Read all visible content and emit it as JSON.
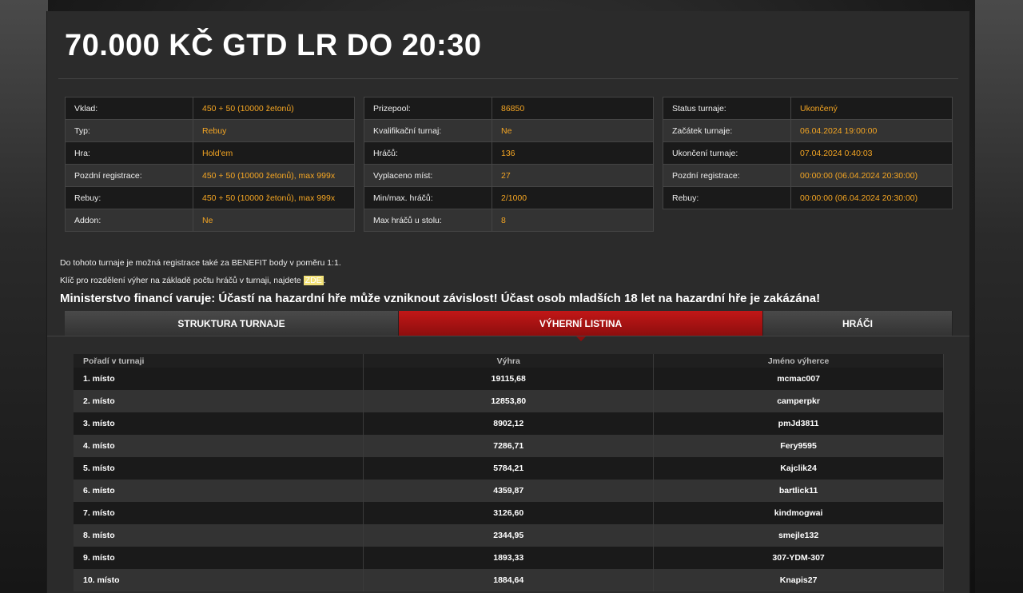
{
  "title": "70.000 KČ GTD LR DO 20:30",
  "info_left": [
    {
      "label": "Vklad:",
      "value": "450 + 50 (10000 žetonů)"
    },
    {
      "label": "Typ:",
      "value": "Rebuy"
    },
    {
      "label": "Hra:",
      "value": "Hold'em"
    },
    {
      "label": "Pozdní registrace:",
      "value": "450 + 50 (10000 žetonů), max 999x"
    },
    {
      "label": "Rebuy:",
      "value": "450 + 50 (10000 žetonů), max 999x"
    },
    {
      "label": "Addon:",
      "value": "Ne"
    }
  ],
  "info_mid": [
    {
      "label": "Prizepool:",
      "value": "86850"
    },
    {
      "label": "Kvalifikační turnaj:",
      "value": "Ne"
    },
    {
      "label": "Hráčů:",
      "value": "136"
    },
    {
      "label": "Vyplaceno míst:",
      "value": "27"
    },
    {
      "label": "Min/max. hráčů:",
      "value": "2/1000"
    },
    {
      "label": "Max hráčů u stolu:",
      "value": "8"
    }
  ],
  "info_right": [
    {
      "label": "Status turnaje:",
      "value": "Ukončený"
    },
    {
      "label": "Začátek turnaje:",
      "value": "06.04.2024 19:00:00"
    },
    {
      "label": "Ukončení turnaje:",
      "value": "07.04.2024 0:40:03"
    },
    {
      "label": "Pozdní registrace:",
      "value": "00:00:00 (06.04.2024 20:30:00)"
    },
    {
      "label": "Rebuy:",
      "value": "00:00:00 (06.04.2024 20:30:00)"
    }
  ],
  "notes": {
    "benefit": "Do tohoto turnaje je možná registrace také za BENEFIT body v poměru 1:1.",
    "key_prefix": "Klíč pro rozdělení výher na základě počtu hráčů v turnaji, najdete ",
    "key_link": "ZDE",
    "key_suffix": "."
  },
  "warning": "Ministerstvo financí varuje: Účastí na hazardní hře může vzniknout závislost! Účast osob mladších 18 let na hazardní hře je zakázána!",
  "tabs": {
    "structure": "STRUKTURA TURNAJE",
    "winners": "VÝHERNÍ LISTINA",
    "players": "HRÁČI"
  },
  "winners_table": {
    "headers": [
      "Pořadí v turnaji",
      "Výhra",
      "Jméno výherce"
    ],
    "rows": [
      [
        "1. místo",
        "19115,68",
        "mcmac007"
      ],
      [
        "2. místo",
        "12853,80",
        "camperpkr"
      ],
      [
        "3. místo",
        "8902,12",
        "pmJd3811"
      ],
      [
        "4. místo",
        "7286,71",
        "Fery9595"
      ],
      [
        "5. místo",
        "5784,21",
        "Kajclik24"
      ],
      [
        "6. místo",
        "4359,87",
        "bartlick11"
      ],
      [
        "7. místo",
        "3126,60",
        "kindmogwai"
      ],
      [
        "8. místo",
        "2344,95",
        "smejle132"
      ],
      [
        "9. místo",
        "1893,33",
        "307-YDM-307"
      ],
      [
        "10. místo",
        "1884,64",
        "Knapis27"
      ]
    ]
  },
  "colors": {
    "accent_value": "#f5a623",
    "active_tab": "#a91212"
  }
}
